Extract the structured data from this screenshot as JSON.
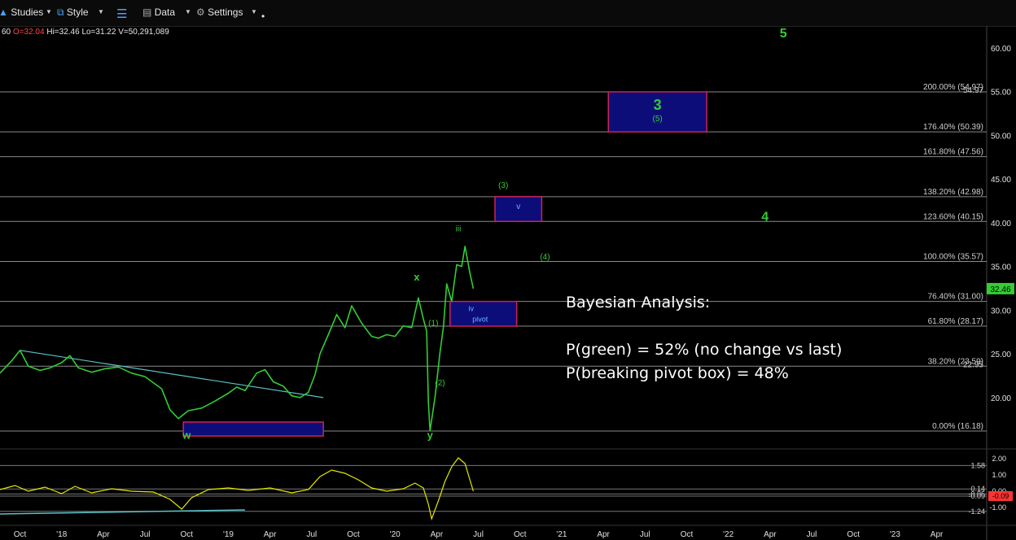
{
  "toolbar": {
    "studies_label": "Studies",
    "style_label": "Style",
    "data_label": "Data",
    "settings_label": "Settings"
  },
  "ohlc": {
    "interval": "60",
    "open": "O=32.04",
    "hi": "Hi=32.46",
    "lo": "Lo=31.22",
    "volume": "V=50,291,089"
  },
  "colors": {
    "price": "#32cd32",
    "fib_line": "#8a8a8a",
    "box_fill": "#0d0d7a",
    "box_border": "#cc2255",
    "label_green": "#33cc33",
    "trendline": "#5bc0c8",
    "osc_yellow": "#e6e600",
    "osc_red": "#ff3333"
  },
  "bayesian": {
    "title": "Bayesian Analysis:",
    "p_green": "P(green) = 52% (no change vs last)",
    "p_pivot": "P(breaking pivot box) = 48%"
  },
  "chart_data": {
    "type": "line",
    "instrument_price": 32.46,
    "price_axis": {
      "range": [
        14.5,
        62.5
      ],
      "ticks": [
        60,
        55,
        50,
        45,
        40,
        35,
        30,
        25,
        20
      ],
      "tick_labels": [
        "60.00",
        "55.00",
        "50.00",
        "45.00",
        "40.00",
        "35.00",
        "30.00",
        "25.00",
        "20.00"
      ],
      "last_price_label": "32.46"
    },
    "time_axis": {
      "ticks": [
        "Oct",
        "'18",
        "Apr",
        "Jul",
        "Oct",
        "'19",
        "Apr",
        "Jul",
        "Oct",
        "'20",
        "Apr",
        "Jul",
        "Oct",
        "'21",
        "Apr",
        "Jul",
        "Oct",
        "'22",
        "Apr",
        "Jul",
        "Oct",
        "'23",
        "Apr"
      ],
      "range": [
        2017.63,
        2023.55
      ]
    },
    "fib_levels": [
      {
        "label": "200.00% (54.97)",
        "value": 54.97,
        "right": "54.97"
      },
      {
        "label": "176.40% (50.39)",
        "value": 50.39
      },
      {
        "label": "161.80% (47.56)",
        "value": 47.56
      },
      {
        "label": "138.20% (42.98)",
        "value": 42.98
      },
      {
        "label": "123.60% (40.15)",
        "value": 40.15
      },
      {
        "label": "100.00% (35.57)",
        "value": 35.57
      },
      {
        "label": "76.40% (31.00)",
        "value": 31.0
      },
      {
        "label": "61.80% (28.17)",
        "value": 28.17
      },
      {
        "label": "38.20% (23.59)",
        "value": 23.59,
        "right": "22.95"
      },
      {
        "label": "0.00% (16.18)",
        "value": 16.18
      }
    ],
    "price_series": [
      [
        2017.63,
        22.8
      ],
      [
        2017.7,
        24.2
      ],
      [
        2017.75,
        25.4
      ],
      [
        2017.8,
        23.6
      ],
      [
        2017.87,
        23.1
      ],
      [
        2017.93,
        23.4
      ],
      [
        2018.0,
        24.0
      ],
      [
        2018.05,
        24.8
      ],
      [
        2018.1,
        23.4
      ],
      [
        2018.18,
        22.9
      ],
      [
        2018.26,
        23.3
      ],
      [
        2018.34,
        23.5
      ],
      [
        2018.42,
        22.8
      ],
      [
        2018.5,
        22.4
      ],
      [
        2018.6,
        21.0
      ],
      [
        2018.65,
        18.6
      ],
      [
        2018.7,
        17.6
      ],
      [
        2018.76,
        18.5
      ],
      [
        2018.84,
        18.8
      ],
      [
        2018.92,
        19.6
      ],
      [
        2019.0,
        20.5
      ],
      [
        2019.05,
        21.2
      ],
      [
        2019.1,
        20.8
      ],
      [
        2019.17,
        22.8
      ],
      [
        2019.22,
        23.2
      ],
      [
        2019.27,
        21.8
      ],
      [
        2019.33,
        21.3
      ],
      [
        2019.38,
        20.2
      ],
      [
        2019.43,
        20.0
      ],
      [
        2019.48,
        20.6
      ],
      [
        2019.52,
        22.6
      ],
      [
        2019.55,
        25.0
      ],
      [
        2019.6,
        27.2
      ],
      [
        2019.65,
        29.5
      ],
      [
        2019.7,
        28.0
      ],
      [
        2019.74,
        30.5
      ],
      [
        2019.8,
        28.5
      ],
      [
        2019.86,
        27.0
      ],
      [
        2019.9,
        26.8
      ],
      [
        2019.95,
        27.2
      ],
      [
        2020.0,
        27.0
      ],
      [
        2020.05,
        28.2
      ],
      [
        2020.1,
        28.0
      ],
      [
        2020.14,
        31.4
      ],
      [
        2020.17,
        29.0
      ],
      [
        2020.19,
        27.6
      ],
      [
        2020.2,
        19.5
      ],
      [
        2020.21,
        16.2
      ],
      [
        2020.24,
        20.0
      ],
      [
        2020.27,
        25.2
      ],
      [
        2020.29,
        28.0
      ],
      [
        2020.31,
        33.0
      ],
      [
        2020.34,
        31.0
      ],
      [
        2020.37,
        35.2
      ],
      [
        2020.4,
        35.0
      ],
      [
        2020.42,
        37.3
      ],
      [
        2020.45,
        34.2
      ],
      [
        2020.47,
        32.46
      ]
    ],
    "boxes": [
      {
        "name": "wave-3-target-box",
        "x": [
          2021.28,
          2021.87
        ],
        "y": [
          50.39,
          54.97
        ],
        "label": "3",
        "sublabel": "(5)"
      },
      {
        "name": "wave-v-target-box",
        "x": [
          2020.6,
          2020.88
        ],
        "y": [
          40.15,
          42.98
        ],
        "label": "v"
      },
      {
        "name": "pivot-box",
        "x": [
          2020.33,
          2020.73
        ],
        "y": [
          28.17,
          31.0
        ],
        "label": "iv",
        "sublabel": "pivot"
      },
      {
        "name": "wave-w-support-box",
        "x": [
          2018.73,
          2019.57
        ],
        "y": [
          15.6,
          17.2
        ]
      }
    ],
    "wave_labels": [
      {
        "text": "5",
        "x": 2022.33,
        "y": 61.2,
        "size": "big"
      },
      {
        "text": "4",
        "x": 2022.22,
        "y": 40.2,
        "size": "big"
      },
      {
        "text": "(3)",
        "x": 2020.65,
        "y": 44.0,
        "size": "small"
      },
      {
        "text": "(4)",
        "x": 2020.9,
        "y": 35.8,
        "size": "small"
      },
      {
        "text": "iii",
        "x": 2020.38,
        "y": 39.0,
        "size": "small"
      },
      {
        "text": "x",
        "x": 2020.13,
        "y": 33.4,
        "size": "medium"
      },
      {
        "text": "(1)",
        "x": 2020.23,
        "y": 28.2,
        "size": "small"
      },
      {
        "text": "(2)",
        "x": 2020.27,
        "y": 21.4,
        "size": "small"
      },
      {
        "text": "y",
        "x": 2020.21,
        "y": 15.3,
        "size": "medium"
      },
      {
        "text": "w",
        "x": 2018.75,
        "y": 15.3,
        "size": "medium"
      }
    ],
    "trendlines": [
      {
        "from": [
          2017.75,
          25.4
        ],
        "to": [
          2019.57,
          20.0
        ]
      }
    ],
    "oscillator": {
      "range": [
        -1.9,
        2.2
      ],
      "ticks": [
        2.0,
        1.0,
        0.0,
        -1.0
      ],
      "tick_labels": [
        "2.00",
        "1.00",
        "0.00",
        "-1.00"
      ],
      "ref_lines": [
        {
          "value": 1.58,
          "label": "1.58"
        },
        {
          "value": 0.14,
          "label": "0.14"
        },
        {
          "value": -0.17,
          "label": "-0.05"
        },
        {
          "value": -0.3,
          "label": "-0.09"
        },
        {
          "value": -1.24,
          "label": "-1.24"
        }
      ],
      "current_label": "-0.09",
      "series": [
        [
          2017.63,
          0.1
        ],
        [
          2017.72,
          0.35
        ],
        [
          2017.8,
          0.0
        ],
        [
          2017.9,
          0.25
        ],
        [
          2018.0,
          -0.15
        ],
        [
          2018.08,
          0.3
        ],
        [
          2018.18,
          -0.1
        ],
        [
          2018.3,
          0.15
        ],
        [
          2018.42,
          0.0
        ],
        [
          2018.55,
          -0.05
        ],
        [
          2018.65,
          -0.5
        ],
        [
          2018.72,
          -1.1
        ],
        [
          2018.78,
          -0.4
        ],
        [
          2018.88,
          0.1
        ],
        [
          2019.0,
          0.2
        ],
        [
          2019.12,
          0.05
        ],
        [
          2019.25,
          0.2
        ],
        [
          2019.38,
          -0.1
        ],
        [
          2019.48,
          0.1
        ],
        [
          2019.55,
          0.9
        ],
        [
          2019.62,
          1.3
        ],
        [
          2019.7,
          1.1
        ],
        [
          2019.78,
          0.7
        ],
        [
          2019.86,
          0.2
        ],
        [
          2019.95,
          0.0
        ],
        [
          2020.05,
          0.15
        ],
        [
          2020.12,
          0.5
        ],
        [
          2020.17,
          0.2
        ],
        [
          2020.2,
          -0.8
        ],
        [
          2020.22,
          -1.7
        ],
        [
          2020.26,
          -0.6
        ],
        [
          2020.3,
          0.6
        ],
        [
          2020.34,
          1.5
        ],
        [
          2020.38,
          2.05
        ],
        [
          2020.42,
          1.7
        ],
        [
          2020.47,
          0.0
        ]
      ],
      "trendline": {
        "from": [
          2017.63,
          -1.4
        ],
        "to": [
          2019.1,
          -1.15
        ]
      }
    }
  }
}
